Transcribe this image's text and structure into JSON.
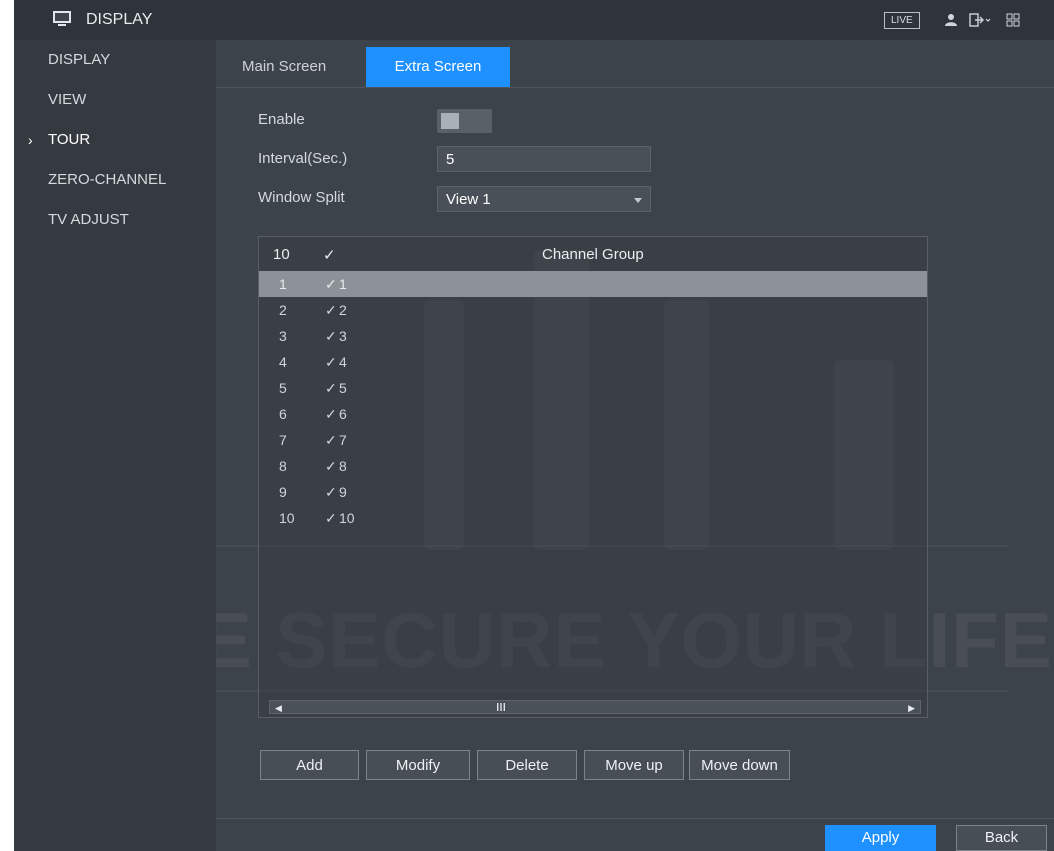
{
  "header": {
    "title": "DISPLAY",
    "live_label": "LIVE",
    "icons": [
      "display-monitor-icon",
      "user-icon",
      "logout-icon",
      "grid-menu-icon"
    ]
  },
  "sidebar": {
    "items": [
      {
        "label": "DISPLAY",
        "active": false
      },
      {
        "label": "VIEW",
        "active": false
      },
      {
        "label": "TOUR",
        "active": true
      },
      {
        "label": "ZERO-CHANNEL",
        "active": false
      },
      {
        "label": "TV ADJUST",
        "active": false
      }
    ],
    "active_marker": "›"
  },
  "tabs": [
    {
      "label": "Main Screen",
      "selected": false
    },
    {
      "label": "Extra Screen",
      "selected": true
    }
  ],
  "form": {
    "enable_label": "Enable",
    "enable_value": false,
    "interval_label": "Interval(Sec.)",
    "interval_value": "5",
    "split_label": "Window Split",
    "split_value": "View 1"
  },
  "table": {
    "header_count": "10",
    "header_check": "✓",
    "header_group": "Channel Group",
    "rows": [
      {
        "num": "1",
        "check": "✓",
        "group": "1",
        "selected": true
      },
      {
        "num": "2",
        "check": "✓",
        "group": "2",
        "selected": false
      },
      {
        "num": "3",
        "check": "✓",
        "group": "3",
        "selected": false
      },
      {
        "num": "4",
        "check": "✓",
        "group": "4",
        "selected": false
      },
      {
        "num": "5",
        "check": "✓",
        "group": "5",
        "selected": false
      },
      {
        "num": "6",
        "check": "✓",
        "group": "6",
        "selected": false
      },
      {
        "num": "7",
        "check": "✓",
        "group": "7",
        "selected": false
      },
      {
        "num": "8",
        "check": "✓",
        "group": "8",
        "selected": false
      },
      {
        "num": "9",
        "check": "✓",
        "group": "9",
        "selected": false
      },
      {
        "num": "10",
        "check": "✓",
        "group": "10",
        "selected": false
      }
    ]
  },
  "actions": {
    "add": "Add",
    "modify": "Modify",
    "delete": "Delete",
    "move_up": "Move up",
    "move_down": "Move down"
  },
  "footer": {
    "apply": "Apply",
    "back": "Back"
  },
  "watermark": "WE SECURE YOUR LIFE",
  "colors": {
    "accent": "#1e90ff",
    "background": "#3d434a",
    "sidebar": "#353a40",
    "selected_row": "#8c9298"
  }
}
